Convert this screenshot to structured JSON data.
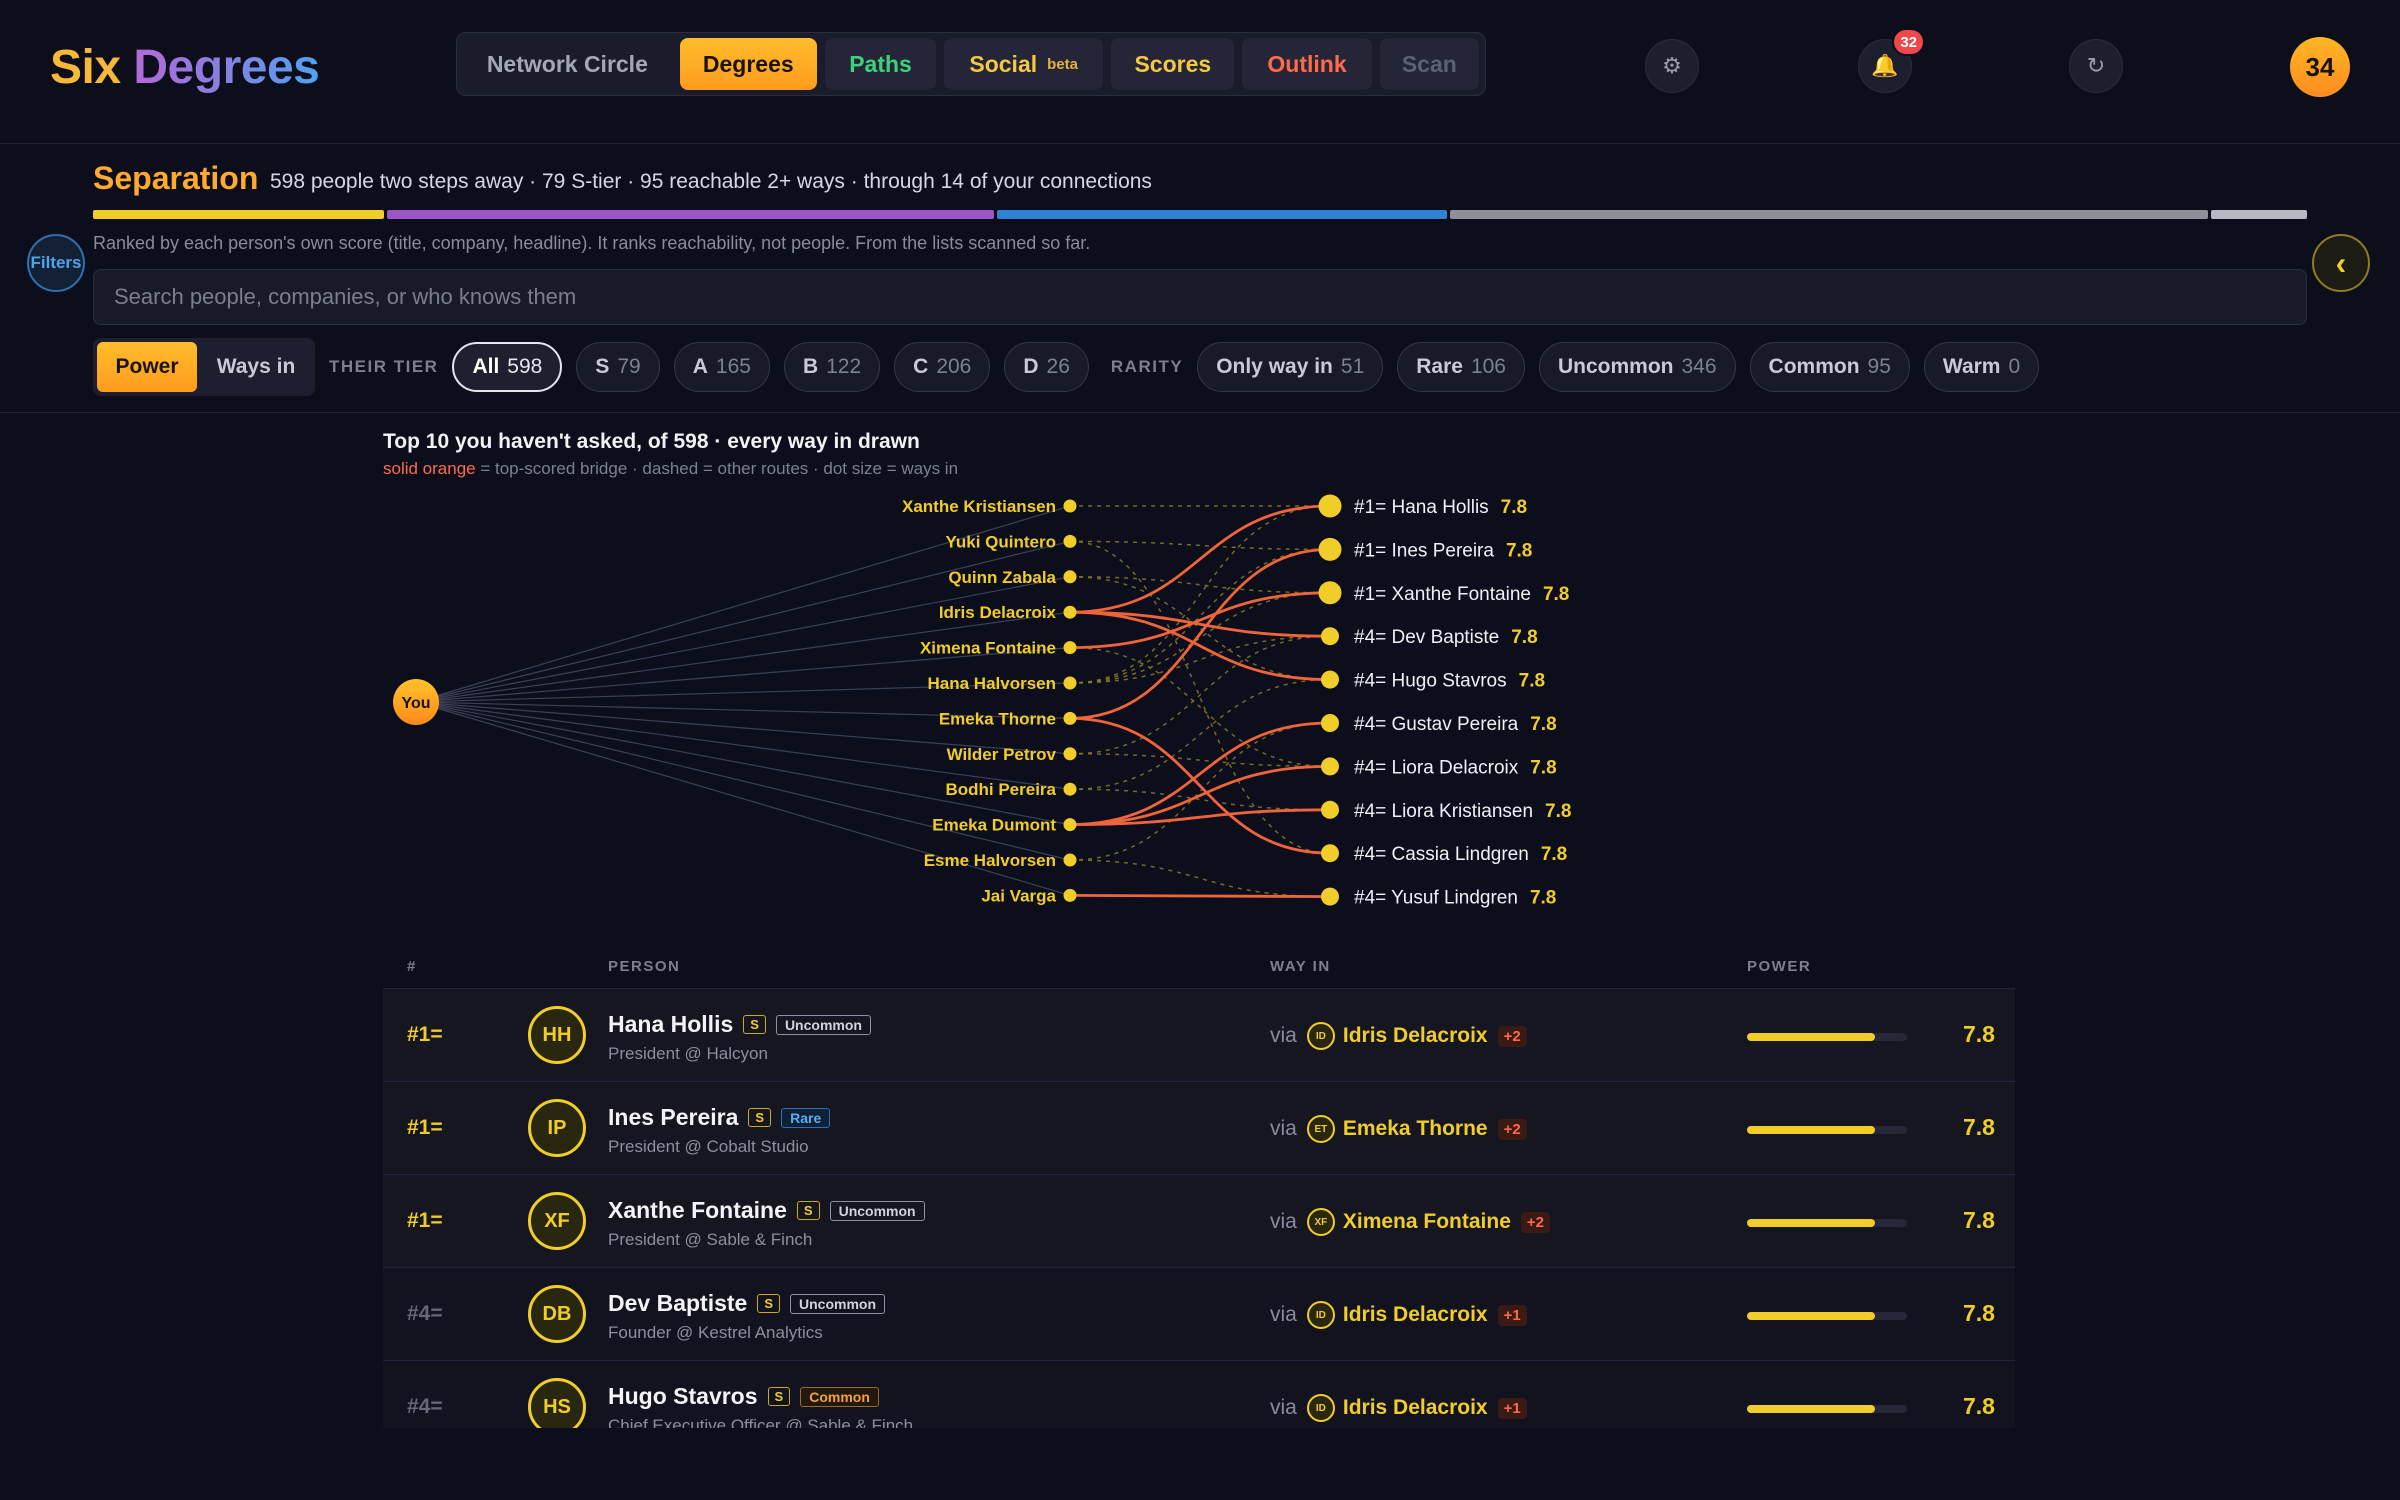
{
  "app": {
    "logo_part1": "Six",
    "logo_part2": "Degrees"
  },
  "nav": {
    "network_circle": "Network Circle",
    "degrees": "Degrees",
    "paths": "Paths",
    "social": "Social",
    "social_beta": "beta",
    "scores": "Scores",
    "outlink": "Outlink",
    "scan": "Scan",
    "active": "Degrees"
  },
  "header": {
    "notifications_count": "32",
    "user_badge": "34",
    "settings_icon": "gear-icon",
    "bell_icon": "bell-icon",
    "refresh_icon": "refresh-icon"
  },
  "separation": {
    "title": "Separation",
    "summary": "598 people two steps away · 79 S-tier · 95 reachable 2+ ways · through 14 of your connections",
    "tier_bar": [
      {
        "tier": "S",
        "count": 79,
        "color": "#f1cd2a"
      },
      {
        "tier": "A",
        "count": 165,
        "color": "#9b55c9"
      },
      {
        "tier": "B",
        "count": 122,
        "color": "#2f82d6"
      },
      {
        "tier": "C",
        "count": 206,
        "color": "#8e9099"
      },
      {
        "tier": "D",
        "count": 26,
        "color": "#b7b9c2"
      }
    ],
    "note": "Ranked by each person's own score (title, company, headline). It ranks reachability, not people. From the lists scanned so far.",
    "filters_label": "Filters",
    "collapse_label": "‹"
  },
  "search": {
    "placeholder": "Search people, companies, or who knows them",
    "value": ""
  },
  "sort_toggle": {
    "power": "Power",
    "ways_in": "Ways in",
    "active": "Power"
  },
  "tier_filter": {
    "label": "THEIR TIER",
    "chips": [
      {
        "label": "All",
        "count": "598",
        "active": true
      },
      {
        "label": "S",
        "count": "79"
      },
      {
        "label": "A",
        "count": "165"
      },
      {
        "label": "B",
        "count": "122"
      },
      {
        "label": "C",
        "count": "206"
      },
      {
        "label": "D",
        "count": "26"
      }
    ]
  },
  "rarity_filter": {
    "label": "RARITY",
    "chips": [
      {
        "label": "Only way in",
        "count": "51"
      },
      {
        "label": "Rare",
        "count": "106"
      },
      {
        "label": "Uncommon",
        "count": "346"
      },
      {
        "label": "Common",
        "count": "95"
      },
      {
        "label": "Warm",
        "count": "0"
      }
    ]
  },
  "graph": {
    "title": "Top 10 you haven't asked, of 598 · every way in drawn",
    "legend_solid": "solid orange",
    "legend_rest": " = top-scored bridge · dashed = other routes · dot size = ways in",
    "you_label": "You",
    "bridges": [
      "Xanthe Kristiansen",
      "Yuki Quintero",
      "Quinn Zabala",
      "Idris Delacroix",
      "Ximena Fontaine",
      "Hana Halvorsen",
      "Emeka Thorne",
      "Wilder Petrov",
      "Bodhi Pereira",
      "Emeka Dumont",
      "Esme Halvorsen",
      "Jai Varga"
    ],
    "targets": [
      {
        "label": "#1= Hana Hollis",
        "score": "7.8"
      },
      {
        "label": "#1= Ines Pereira",
        "score": "7.8"
      },
      {
        "label": "#1= Xanthe Fontaine",
        "score": "7.8"
      },
      {
        "label": "#4= Dev Baptiste",
        "score": "7.8"
      },
      {
        "label": "#4= Hugo Stavros",
        "score": "7.8"
      },
      {
        "label": "#4= Gustav Pereira",
        "score": "7.8"
      },
      {
        "label": "#4= Liora Delacroix",
        "score": "7.8"
      },
      {
        "label": "#4= Liora Kristiansen",
        "score": "7.8"
      },
      {
        "label": "#4= Cassia Lindgren",
        "score": "7.8"
      },
      {
        "label": "#4= Yusuf Lindgren",
        "score": "7.8"
      }
    ],
    "target_ways": [
      3,
      3,
      3,
      2,
      2,
      2,
      2,
      2,
      2,
      2
    ],
    "solid_links": [
      [
        3,
        0
      ],
      [
        6,
        1
      ],
      [
        4,
        2
      ],
      [
        3,
        3
      ],
      [
        3,
        4
      ],
      [
        9,
        5
      ],
      [
        9,
        6
      ],
      [
        9,
        7
      ],
      [
        6,
        8
      ],
      [
        11,
        9
      ]
    ],
    "dashed_links": [
      [
        0,
        0
      ],
      [
        1,
        1
      ],
      [
        5,
        0
      ],
      [
        2,
        2
      ],
      [
        5,
        1
      ],
      [
        5,
        2
      ],
      [
        7,
        3
      ],
      [
        8,
        4
      ],
      [
        10,
        5
      ],
      [
        4,
        6
      ],
      [
        8,
        7
      ],
      [
        1,
        8
      ],
      [
        10,
        9
      ],
      [
        7,
        6
      ],
      [
        2,
        4
      ],
      [
        5,
        3
      ]
    ]
  },
  "table": {
    "headers": {
      "rank": "#",
      "person": "PERSON",
      "way_in": "WAY IN",
      "power": "POWER"
    },
    "rows": [
      {
        "rank": "#1=",
        "initials": "HH",
        "name": "Hana Hollis",
        "tier": "S",
        "rarity": "Uncommon",
        "role": "President @ Halcyon",
        "via": "via",
        "bridge_initials": "ID",
        "bridge": "Idris Delacroix",
        "extra": "+2",
        "power_pct": 80,
        "power": "7.8"
      },
      {
        "rank": "#1=",
        "initials": "IP",
        "name": "Ines Pereira",
        "tier": "S",
        "rarity": "Rare",
        "role": "President @ Cobalt Studio",
        "via": "via",
        "bridge_initials": "ET",
        "bridge": "Emeka Thorne",
        "extra": "+2",
        "power_pct": 80,
        "power": "7.8"
      },
      {
        "rank": "#1=",
        "initials": "XF",
        "name": "Xanthe Fontaine",
        "tier": "S",
        "rarity": "Uncommon",
        "role": "President @ Sable & Finch",
        "via": "via",
        "bridge_initials": "XF",
        "bridge": "Ximena Fontaine",
        "extra": "+2",
        "power_pct": 80,
        "power": "7.8"
      },
      {
        "rank": "#4=",
        "initials": "DB",
        "name": "Dev Baptiste",
        "tier": "S",
        "rarity": "Uncommon",
        "role": "Founder @ Kestrel Analytics",
        "via": "via",
        "bridge_initials": "ID",
        "bridge": "Idris Delacroix",
        "extra": "+1",
        "power_pct": 80,
        "power": "7.8"
      },
      {
        "rank": "#4=",
        "initials": "HS",
        "name": "Hugo Stavros",
        "tier": "S",
        "rarity": "Common",
        "role": "Chief Executive Officer @ Sable & Finch",
        "via": "via",
        "bridge_initials": "ID",
        "bridge": "Idris Delacroix",
        "extra": "+1",
        "power_pct": 80,
        "power": "7.8"
      }
    ]
  }
}
